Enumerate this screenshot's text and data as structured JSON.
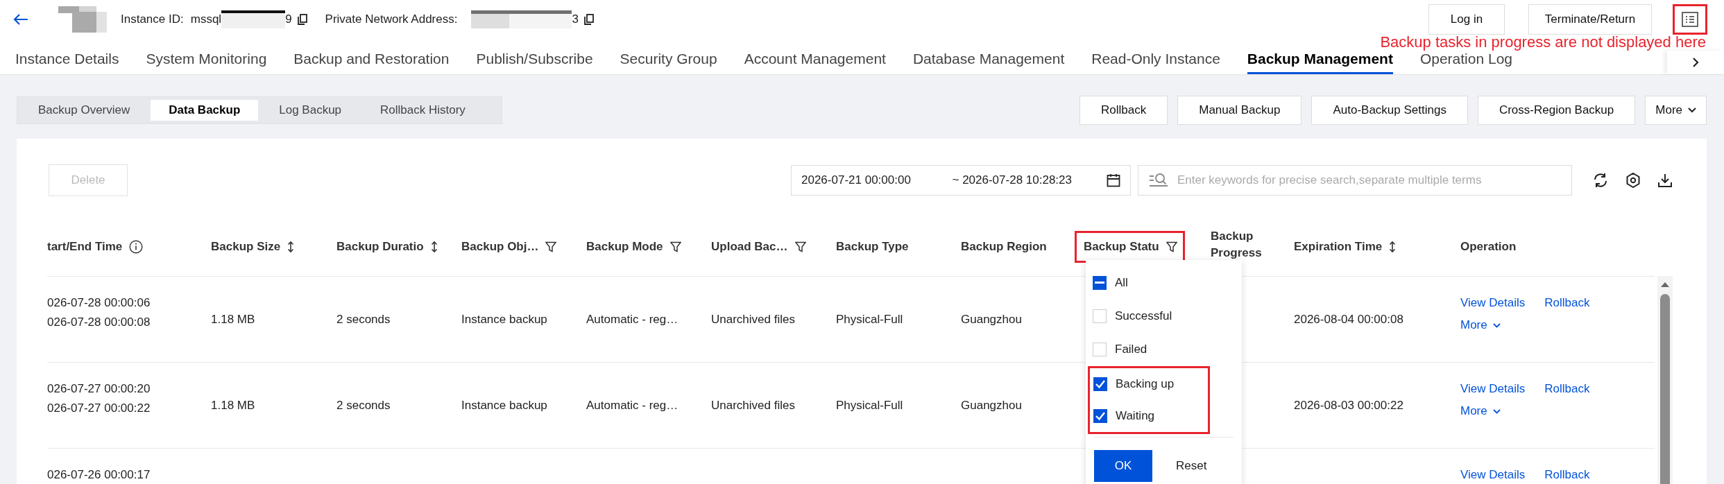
{
  "header": {
    "instance_id_label": "Instance ID:",
    "instance_id_prefix": "mssql",
    "instance_id_suffix": "9",
    "address_label": "Private Network Address:",
    "address_suffix": "3",
    "buttons": [
      "Log in",
      "Terminate/Return"
    ],
    "task_icon_highlighted": true
  },
  "annotation": "Backup tasks in progress are not displayed here",
  "tabs": [
    {
      "label": "Instance Details",
      "selected": false
    },
    {
      "label": "System Monitoring",
      "selected": false
    },
    {
      "label": "Backup and Restoration",
      "selected": false
    },
    {
      "label": "Publish/Subscribe",
      "selected": false
    },
    {
      "label": "Security Group",
      "selected": false
    },
    {
      "label": "Account Management",
      "selected": false
    },
    {
      "label": "Database Management",
      "selected": false
    },
    {
      "label": "Read-Only Instance",
      "selected": false
    },
    {
      "label": "Backup Management",
      "selected": true
    },
    {
      "label": "Operation Log",
      "selected": false
    }
  ],
  "subtabs": [
    {
      "label": "Backup Overview",
      "selected": false
    },
    {
      "label": "Data Backup",
      "selected": true
    },
    {
      "label": "Log Backup",
      "selected": false
    },
    {
      "label": "Rollback History",
      "selected": false
    }
  ],
  "actions": [
    "Rollback",
    "Manual Backup",
    "Auto-Backup Settings",
    "Cross-Region Backup"
  ],
  "more": "More",
  "toolbar": {
    "delete": {
      "label": "Delete",
      "disabled": true
    },
    "date_start": "2026-07-21 00:00:00",
    "date_sep": "~",
    "date_end": "2026-07-28 10:28:23",
    "search_placeholder": "Enter keywords for precise search,separate multiple terms"
  },
  "table": {
    "columns": [
      {
        "label": "tart/End Time",
        "highlighted": false
      },
      {
        "label": "Backup Size",
        "highlighted": false
      },
      {
        "label": "Backup Duratio",
        "highlighted": false
      },
      {
        "label": "Backup Obj…",
        "highlighted": false
      },
      {
        "label": "Backup Mode",
        "highlighted": false
      },
      {
        "label": "Upload Bac…",
        "highlighted": false
      },
      {
        "label": "Backup Type",
        "highlighted": false
      },
      {
        "label": "Backup Region",
        "highlighted": false
      },
      {
        "label": "Backup Statu",
        "highlighted": true
      },
      {
        "label": "Backup Progress",
        "highlighted": false
      },
      {
        "label": "Expiration Time",
        "highlighted": false
      },
      {
        "label": "Operation",
        "highlighted": false
      }
    ],
    "rows": [
      {
        "times": [
          "026-07-28 00:00:06",
          "026-07-28 00:00:08"
        ],
        "size": "1.18 MB",
        "duration": "2 seconds",
        "object": "Instance backup",
        "mode": "Automatic - reg…",
        "upload": "Unarchived files",
        "type": "Physical-Full",
        "region": "Guangzhou",
        "expiration": "2026-08-04 00:00:08",
        "actions": [
          "View Details",
          "Rollback"
        ],
        "more": "More"
      },
      {
        "times": [
          "026-07-27 00:00:20",
          "026-07-27 00:00:22"
        ],
        "size": "1.18 MB",
        "duration": "2 seconds",
        "object": "Instance backup",
        "mode": "Automatic - reg…",
        "upload": "Unarchived files",
        "type": "Physical-Full",
        "region": "Guangzhou",
        "expiration": "2026-08-03 00:00:22",
        "actions": [
          "View Details",
          "Rollback"
        ],
        "more": "More"
      },
      {
        "times": [
          "026-07-26 00:00:17"
        ],
        "actions": [
          "View Details",
          "Rollback"
        ]
      }
    ]
  },
  "filter": {
    "options": [
      {
        "label": "All",
        "checked": true,
        "partial": true,
        "highlighted": false
      },
      {
        "label": "Successful",
        "checked": false,
        "highlighted": false
      },
      {
        "label": "Failed",
        "checked": false,
        "highlighted": false
      },
      {
        "label": "Backing up",
        "checked": true,
        "highlighted": true
      },
      {
        "label": "Waiting",
        "checked": true,
        "highlighted": true
      }
    ],
    "ok": "OK",
    "reset": "Reset"
  }
}
